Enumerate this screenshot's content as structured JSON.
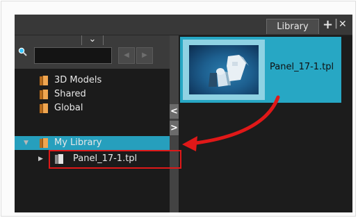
{
  "panel": {
    "tab_label": "Library",
    "tab_buttons": {
      "add_icon": "+",
      "separator": "|",
      "close_icon": "✕"
    }
  },
  "toolbar": {
    "menu_toggle_icon": "chevron-down-icon",
    "menu_toggle_glyph": "⌄",
    "search": {
      "value": "",
      "placeholder": ""
    },
    "prev_glyph": "◀",
    "next_glyph": "▶"
  },
  "tree": {
    "items": [
      {
        "label": "3D Models",
        "icon": "library-folder-icon",
        "expanded": null
      },
      {
        "label": "Shared",
        "icon": "library-folder-icon",
        "expanded": null
      },
      {
        "label": "Global",
        "icon": "library-folder-icon",
        "expanded": null
      },
      {
        "label": "My Library",
        "icon": "library-folder-icon",
        "expanded": true,
        "selected": true
      },
      {
        "label": "Panel_17-1.tpl",
        "icon": "template-folder-icon",
        "expanded": false,
        "child": true
      }
    ],
    "expanded_glyph": "▼",
    "collapsed_glyph": "▶"
  },
  "splitter": {
    "collapse_left_glyph": "<",
    "collapse_right_glyph": ">"
  },
  "content": {
    "items": [
      {
        "label": "Panel_17-1.tpl",
        "thumbnail": "template-thumbnail",
        "selected": true
      }
    ]
  },
  "colors": {
    "selection": "#269fbd",
    "annotation": "#e01818",
    "panel_bg": "#1c1c1c",
    "toolbar_bg": "#3b3b3b"
  }
}
